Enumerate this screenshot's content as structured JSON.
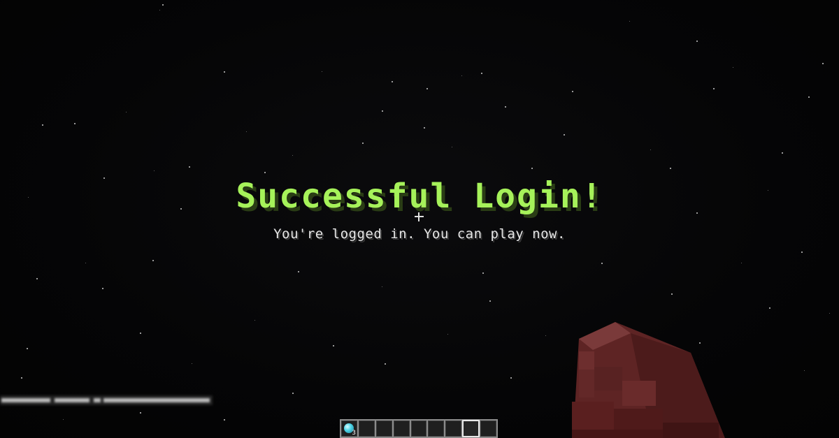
{
  "announcement": {
    "title": "Successful Login!",
    "subtitle": "You're logged in. You can play now."
  },
  "hotbar": {
    "slots": [
      {
        "item": "diamond",
        "icon": "diamond-icon",
        "count": "3"
      },
      {
        "item": ""
      },
      {
        "item": ""
      },
      {
        "item": ""
      },
      {
        "item": ""
      },
      {
        "item": ""
      },
      {
        "item": ""
      },
      {
        "item": ""
      },
      {
        "item": ""
      }
    ],
    "selected_index": 7
  },
  "colors": {
    "title": "#a6f25a",
    "title_shadow": "#2a3d15",
    "subtitle": "#e6e6e6",
    "sky": "#050505",
    "arm": "#6e2a2a"
  }
}
